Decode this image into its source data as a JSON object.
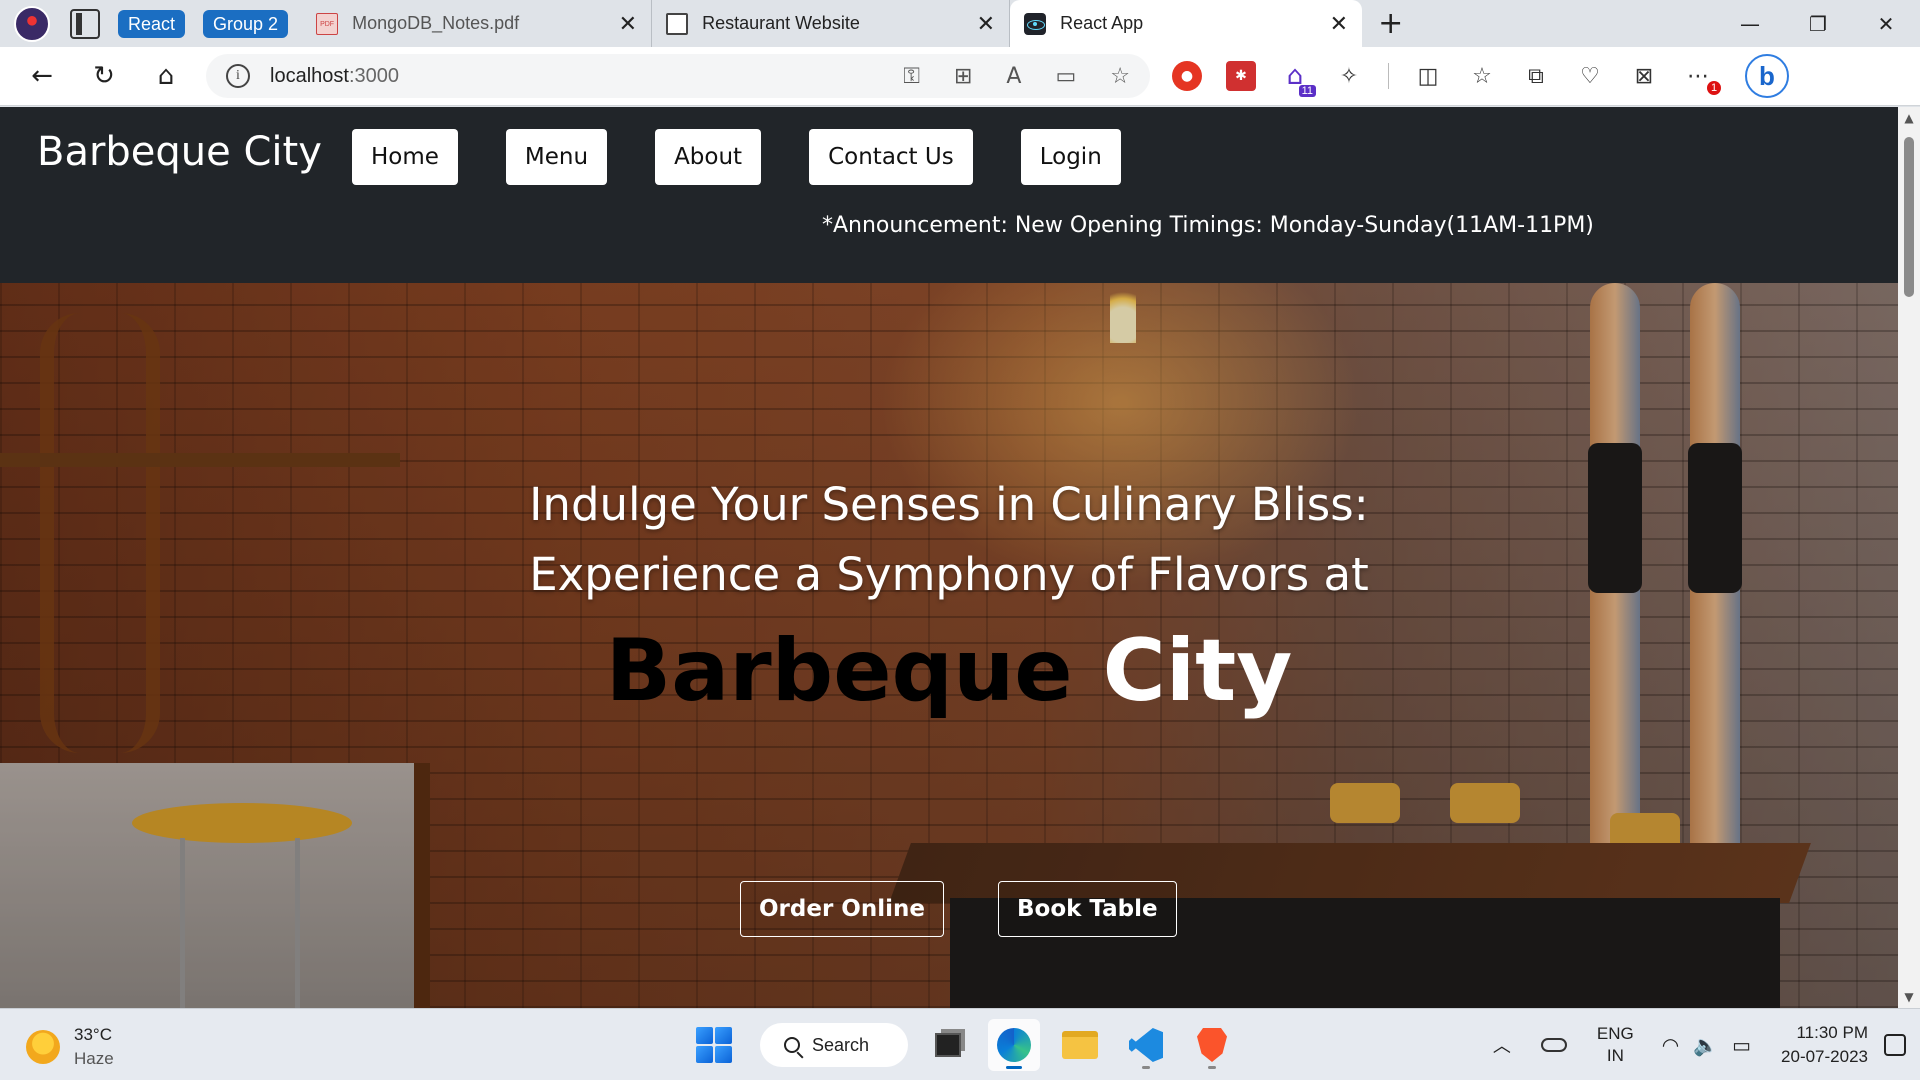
{
  "browser": {
    "tab_groups": [
      "React",
      "Group 2"
    ],
    "tabs": [
      {
        "title": "MongoDB_Notes.pdf",
        "icon": "pdf-icon",
        "active": false
      },
      {
        "title": "Restaurant Website",
        "icon": "document-icon",
        "active": false
      },
      {
        "title": "React App",
        "icon": "react-icon",
        "active": true
      }
    ],
    "address": {
      "host": "localhost",
      "port": ":3000"
    },
    "extension_badges": {
      "capture": "11",
      "menu": "1"
    }
  },
  "site": {
    "brand": "Barbeque City",
    "nav": [
      "Home",
      "Menu",
      "About",
      "Contact Us",
      "Login"
    ],
    "announcement": "*Announcement: New Opening Timings: Monday-Sunday(11AM-11PM)",
    "hero": {
      "line1": "Indulge Your Senses in Culinary Bliss:",
      "line2": "Experience a Symphony of Flavors at",
      "brand_part1": "Barbeque",
      "brand_part2": "City",
      "buttons": [
        "Order Online",
        "Book Table"
      ]
    },
    "colors": {
      "nav_bg": "#212529",
      "brand_dark": "#000000",
      "brand_light": "#ffffff"
    }
  },
  "taskbar": {
    "weather": {
      "temp": "33°C",
      "condition": "Haze"
    },
    "search_label": "Search",
    "language": {
      "lang": "ENG",
      "region": "IN"
    },
    "clock": {
      "time": "11:30 PM",
      "date": "20-07-2023"
    }
  }
}
